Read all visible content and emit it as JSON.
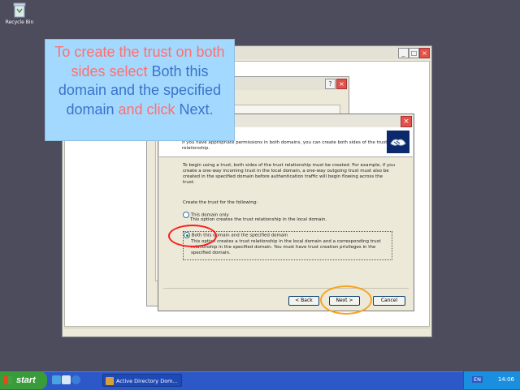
{
  "desktop": {
    "recycle_bin_label": "Recycle Bin"
  },
  "callout": {
    "part1": "To create the trust on both sides select ",
    "part2": "Both this domain and the specified domain",
    "part3": " and click ",
    "part4": "Next."
  },
  "wizard": {
    "header_text": "If you have appropriate permissions in both domains, you can create both sides of the trust relationship.",
    "intro": "To begin using a trust, both sides of the trust relationship must be created. For example, if you create a one-way incoming trust in the local domain, a one-way outgoing trust must also be created in the specified domain before authentication traffic will begin flowing across the trust.",
    "create_label": "Create the trust for the following:",
    "option1_label": "This domain only",
    "option1_desc": "This option creates the trust relationship in the local domain.",
    "option2_label": "Both this domain and the specified domain",
    "option2_desc": "This option creates a trust relationship in the local domain and a corresponding trust relationship in the specified domain. You must have trust creation privileges in the specified domain.",
    "back_label": "< Back",
    "next_label": "Next >",
    "cancel_label": "Cancel"
  },
  "taskbar": {
    "start_label": "start",
    "task_label": "Active Directory Dom...",
    "lang": "EN",
    "clock": "14:06"
  },
  "colors": {
    "callout_bg": "#a3d9ff",
    "callout_red": "#ff6f6f",
    "callout_blue": "#3a73c9",
    "highlight_red": "#ff1a1a",
    "highlight_orange": "#f7a421"
  }
}
